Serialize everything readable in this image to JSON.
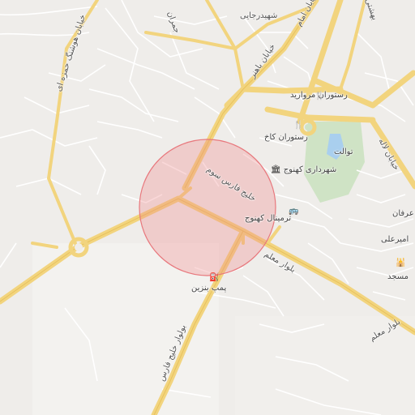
{
  "map": {
    "highlight_color": "#f0868a",
    "roads": {
      "shahid_rajai": "شهیدرجایی",
      "khiaban_bahonar": "خیابان باهنر",
      "khiaban_mutahhari": "خیابان مطهری",
      "khiaban_imam": "خیابان امام",
      "khiaban_jamran": "جمران",
      "khiaban_laleh": "خیابان لاله",
      "khiaban_beheshti": "بهشتی",
      "khiaban_hushang": "خیابان هوشنگ حمزه ای",
      "khalij_fars_center": "خلیج فارس سوم",
      "bolvar_moallem_1": "بلوار معلم",
      "bolvar_moallem_2": "بلوار معلم",
      "bolvar_khalij_fars": "بولوار خلیج فارس"
    },
    "pois": {
      "restaurant_morvarid": "رستوران مروارید",
      "restaurant_kakh": "رستوران کاخ",
      "toilet": "توالت",
      "municipality": "شهرداری کهنوج",
      "terminal": "ترمینال کهنوج",
      "gas_station": "پمپ بنزین",
      "erfan": "عرفان",
      "amirali": "امیرعلی",
      "mosque": "مسجد"
    },
    "icons": {
      "restaurant": "restaurant-icon",
      "toilet": "toilet-icon",
      "municipality": "museum-icon",
      "terminal": "bus-icon",
      "gas_station": "fuel-icon",
      "mosque": "mosque-icon"
    }
  }
}
